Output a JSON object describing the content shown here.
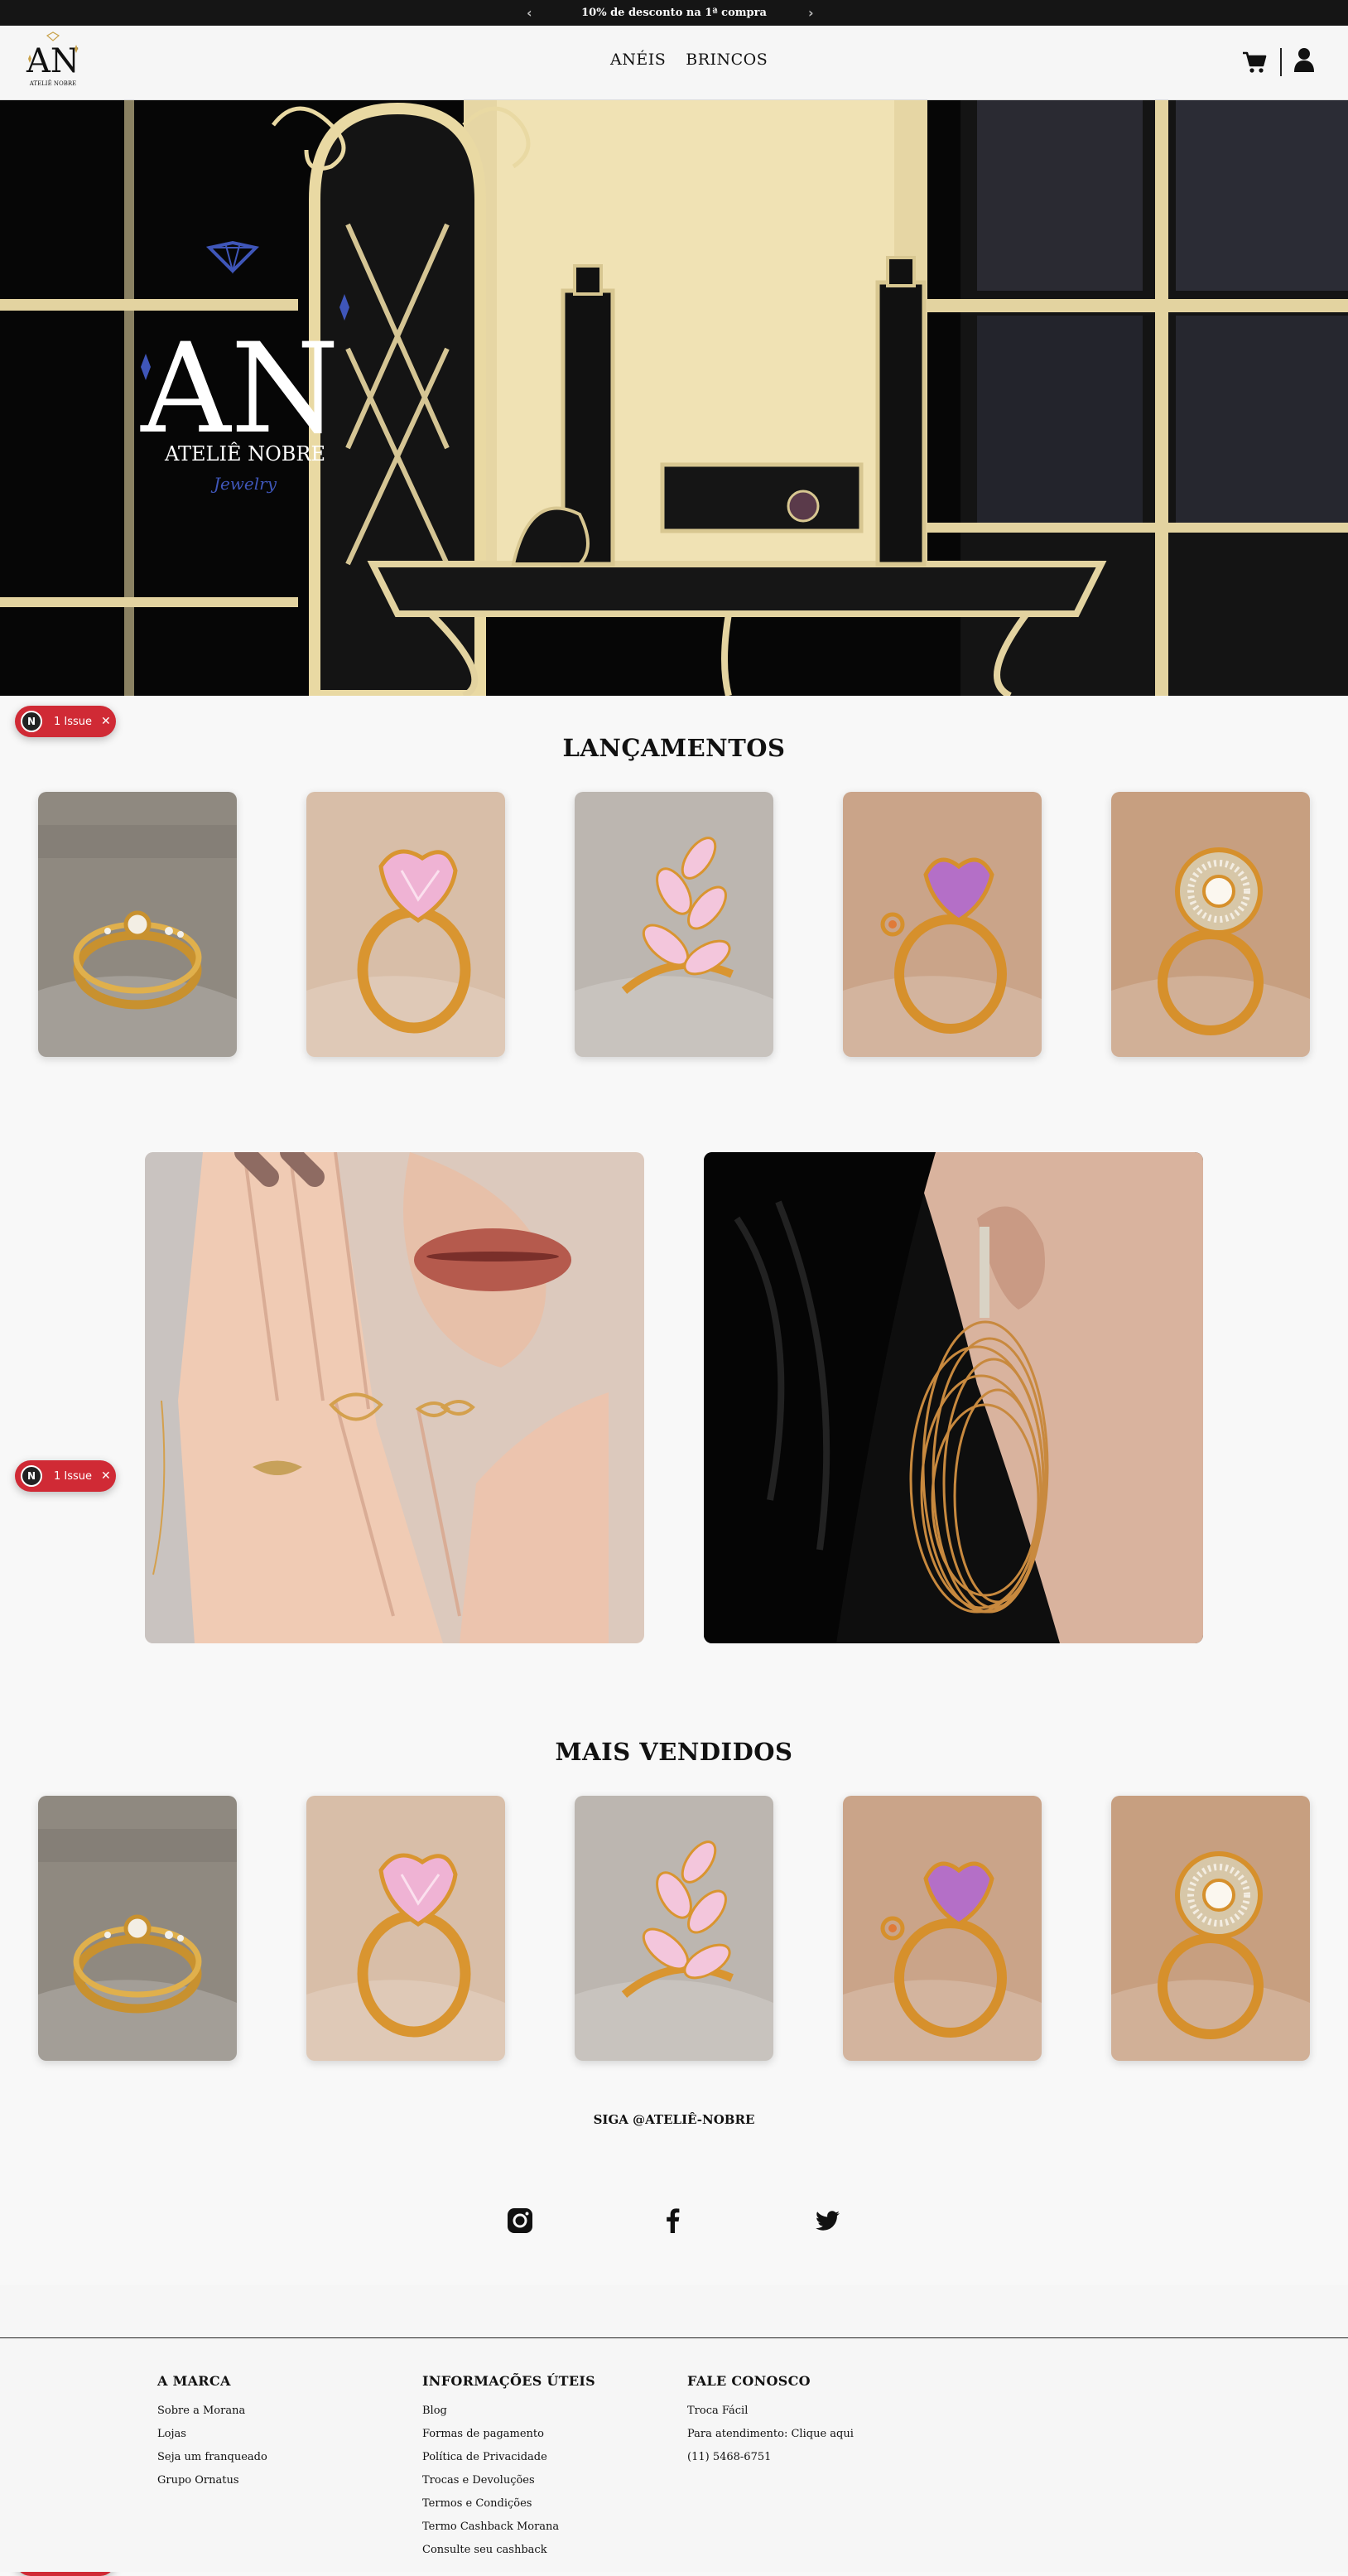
{
  "promo": {
    "text": "10% de desconto na 1ª compra",
    "prev_icon": "chevron-left-icon",
    "next_icon": "chevron-right-icon"
  },
  "header": {
    "logo_text": "ATELIÊ NOBRE",
    "nav": [
      "ANÉIS",
      "BRINCOS"
    ],
    "cart_icon": "cart-icon",
    "user_icon": "user-icon"
  },
  "hero": {
    "logo_letters": "AN",
    "brand": "ATELIÊ NOBRE",
    "tagline": "Jewelry"
  },
  "issue_badge": {
    "count_label": "1 Issue",
    "letter": "N"
  },
  "lancamentos": {
    "title": "LANÇAMENTOS",
    "products": [
      {
        "kind": "gold-band-ring",
        "bg": "#8f8980"
      },
      {
        "kind": "pink-heart-ring",
        "bg": "#d8bea8"
      },
      {
        "kind": "pink-leaf-ring",
        "bg": "#bcb6b0"
      },
      {
        "kind": "purple-heart-ring",
        "bg": "#caa489"
      },
      {
        "kind": "spiral-ring",
        "bg": "#c79f80"
      }
    ]
  },
  "banners": [
    {
      "kind": "hand-rings",
      "bg": "#d9c7bc"
    },
    {
      "kind": "hoop-earring",
      "bg": "#0d0d0d"
    }
  ],
  "mais_vendidos": {
    "title": "MAIS VENDIDOS",
    "products": [
      {
        "kind": "gold-band-ring",
        "bg": "#8f8980"
      },
      {
        "kind": "pink-heart-ring",
        "bg": "#d8bea8"
      },
      {
        "kind": "pink-leaf-ring",
        "bg": "#bcb6b0"
      },
      {
        "kind": "purple-heart-ring",
        "bg": "#caa489"
      },
      {
        "kind": "spiral-ring",
        "bg": "#c79f80"
      }
    ]
  },
  "follow": {
    "text": "SIGA @ATELIÊ-NOBRE",
    "social": [
      "instagram-icon",
      "facebook-icon",
      "twitter-icon"
    ]
  },
  "footer": {
    "marca": {
      "title": "A MARCA",
      "links": [
        "Sobre a Morana",
        "Lojas",
        "Seja um franqueado",
        "Grupo Ornatus"
      ]
    },
    "info": {
      "title": "INFORMAÇÕES ÚTEIS",
      "links": [
        "Blog",
        "Formas de pagamento",
        "Política de Privacidade",
        "Trocas e Devoluções",
        "Termos e Condições",
        "Termo Cashback Morana",
        "Consulte seu cashback"
      ]
    },
    "contato": {
      "title": "FALE CONOSCO",
      "links": [
        "Troca Fácil",
        "Para atendimento: Clique aqui",
        "(11) 5468-6751"
      ]
    }
  },
  "colors": {
    "promo_bg": "#151515",
    "issue_red": "#d02a35",
    "gold": "#d49a3a"
  }
}
